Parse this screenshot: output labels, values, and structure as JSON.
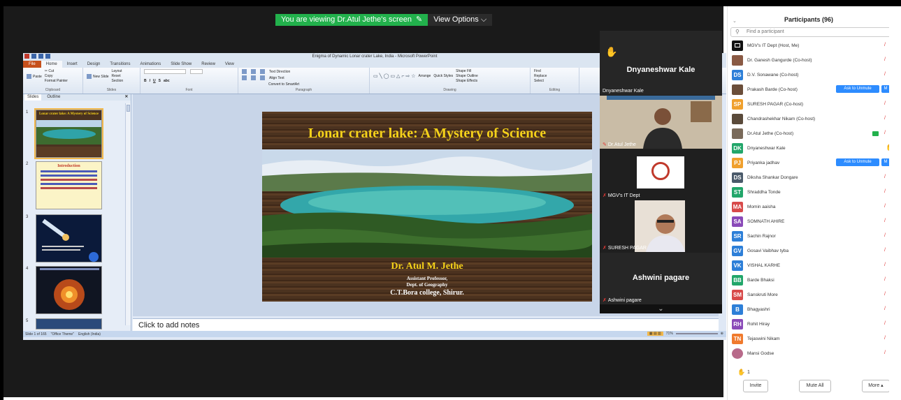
{
  "banner": {
    "viewing": "You are viewing Dr.Atul Jethe's screen",
    "options": "View Options",
    "colors": {
      "green": "#22b14c"
    }
  },
  "ppt": {
    "window_title": "Enigma of Dynamic Lonar crater Lake, India  -  Microsoft PowerPoint",
    "tabs": [
      "File",
      "Home",
      "Insert",
      "Design",
      "Transitions",
      "Animations",
      "Slide Show",
      "Review",
      "View"
    ],
    "ribbon": {
      "clipboard": {
        "label": "Clipboard",
        "paste": "Paste",
        "cut": "Cut",
        "copy": "Copy",
        "format_painter": "Format Painter"
      },
      "slides": {
        "label": "Slides",
        "new_slide": "New Slide",
        "layout": "Layout",
        "reset": "Reset",
        "section": "Section"
      },
      "font": {
        "label": "Font"
      },
      "paragraph": {
        "label": "Paragraph",
        "text_direction": "Text Direction",
        "align_text": "Align Text",
        "convert": "Convert to SmartArt"
      },
      "drawing": {
        "label": "Drawing",
        "arrange": "Arrange",
        "quick_styles": "Quick Styles",
        "shape_fill": "Shape Fill",
        "shape_outline": "Shape Outline",
        "shape_effects": "Shape Effects"
      },
      "editing": {
        "label": "Editing",
        "find": "Find",
        "replace": "Replace",
        "select": "Select"
      }
    },
    "pane_tabs": {
      "slides": "Slides",
      "outline": "Outline"
    },
    "thumbnails": [
      {
        "num": "1",
        "title": "Lonar crater lake: A Mystery of Science"
      },
      {
        "num": "2",
        "title": "Introduction"
      },
      {
        "num": "3"
      },
      {
        "num": "4"
      },
      {
        "num": "5"
      }
    ],
    "slide": {
      "title": "Lonar crater lake: A Mystery of Science",
      "author": "Dr. Atul M. Jethe",
      "line1": "Assistant Professor,",
      "line2": "Dept. of Geography",
      "line3": "C.T.Bora college, Shirur."
    },
    "notes_placeholder": "Click to add notes",
    "status": {
      "slide": "Slide 1 of 165",
      "theme": "\"Office Theme\"",
      "lang": "English (India)",
      "zoom": "71%"
    }
  },
  "gallery": {
    "tiles": [
      {
        "big_name": "Dnyaneshwar Kale",
        "caption": "Dnyaneshwar Kale"
      },
      {
        "caption": "Dr.Atul Jethe"
      },
      {
        "caption": "MGV's IT Dept"
      },
      {
        "caption": "SURESH PAGAR"
      },
      {
        "big_name": "Ashwini pagare",
        "caption": "Ashwini pagare"
      }
    ]
  },
  "participants": {
    "title": "Participants (96)",
    "search_placeholder": "Find a participant",
    "ask_to_unmute": "Ask to Unmute",
    "unmute_short": "M",
    "list": [
      {
        "initials": "",
        "name": "MGV's IT Dept (Host, Me)",
        "color": "#111111"
      },
      {
        "initials": "",
        "name": "Dr. Ganesh Gangurde (Co-host)",
        "color": "#8a5a44"
      },
      {
        "initials": "DS",
        "name": "D.V. Sonawane (Co-host)",
        "color": "#2d7fd8"
      },
      {
        "initials": "",
        "name": "Prakash Barde (Co-host)",
        "color": "#6b4e3a"
      },
      {
        "initials": "SP",
        "name": "SURESH PAGAR (Co-host)",
        "color": "#f0a02d"
      },
      {
        "initials": "",
        "name": "Chandrashekhar Nikam (Co-host)",
        "color": "#5a4a3a"
      },
      {
        "initials": "",
        "name": "Dr.Atul Jethe (Co-host)",
        "color": "#7a6a5a"
      },
      {
        "initials": "DK",
        "name": "Dnyaneshwar Kale",
        "color": "#22a66a"
      },
      {
        "initials": "PJ",
        "name": "Priyanka jadhav",
        "color": "#f0a02d"
      },
      {
        "initials": "DS",
        "name": "Diksha Shankar Dongare",
        "color": "#4a5a6a"
      },
      {
        "initials": "ST",
        "name": "Shraddha Tonde",
        "color": "#22a66a"
      },
      {
        "initials": "MA",
        "name": "Momin aaisha",
        "color": "#d84a4a"
      },
      {
        "initials": "SA",
        "name": "SOMNATH AHIRE",
        "color": "#8a4ab8"
      },
      {
        "initials": "SR",
        "name": "Sachin Rajnor",
        "color": "#2d7fd8"
      },
      {
        "initials": "GV",
        "name": "Gosavi Vaibhav tyba",
        "color": "#2d7fd8"
      },
      {
        "initials": "VK",
        "name": "VISHAL KARHE",
        "color": "#2d7fd8"
      },
      {
        "initials": "BB",
        "name": "Barde Bhaksi",
        "color": "#22a66a"
      },
      {
        "initials": "SM",
        "name": "Sanskruti More",
        "color": "#d84a4a"
      },
      {
        "initials": "B",
        "name": "Bhagyashri",
        "color": "#2d7fd8"
      },
      {
        "initials": "RH",
        "name": "Rohit Hiray",
        "color": "#8a4ab8"
      },
      {
        "initials": "TN",
        "name": "Tejaswini Nikam",
        "color": "#f07a2d"
      },
      {
        "initials": "",
        "name": "Mansi Godse",
        "color": "#b86a8a"
      }
    ],
    "raised_count": "1",
    "footer": {
      "invite": "Invite",
      "mute_all": "Mute All",
      "more": "More"
    }
  }
}
